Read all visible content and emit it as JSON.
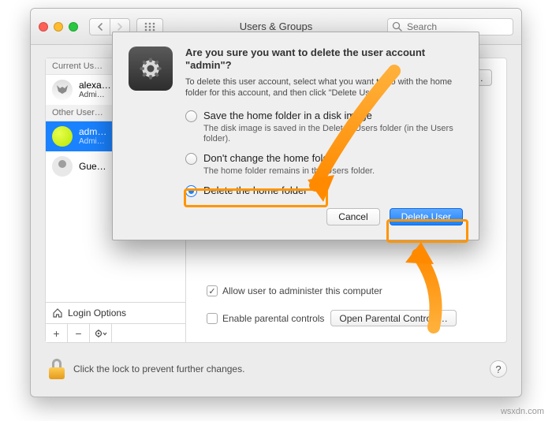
{
  "window": {
    "title": "Users & Groups",
    "search_placeholder": "Search"
  },
  "sidebar": {
    "sections": {
      "current": "Current Us…",
      "other": "Other User…"
    },
    "current_user": {
      "name": "alexa…",
      "role": "Admi…"
    },
    "other_users": [
      {
        "name": "adm…",
        "role": "Admi…"
      },
      {
        "name": "Gue…",
        "role": ""
      }
    ],
    "login_options": "Login Options"
  },
  "right": {
    "change_password": "rd…",
    "allow_admin": "Allow user to administer this computer",
    "enable_parental": "Enable parental controls",
    "open_parental": "Open Parental Controls…"
  },
  "lock_text": "Click the lock to prevent further changes.",
  "sheet": {
    "title": "Are you sure you want to delete the user account \"admin\"?",
    "desc": "To delete this user account, select what you want to do with the home folder for this account, and then click \"Delete User\".",
    "opt1": {
      "label": "Save the home folder in a disk image",
      "hint": "The disk image is saved in the Deleted Users folder (in the Users folder)."
    },
    "opt2": {
      "label": "Don't change the home folder",
      "hint": "The home folder remains in the Users folder."
    },
    "opt3": {
      "label": "Delete the home folder"
    },
    "cancel": "Cancel",
    "delete": "Delete User"
  },
  "watermark": "wsxdn.com"
}
